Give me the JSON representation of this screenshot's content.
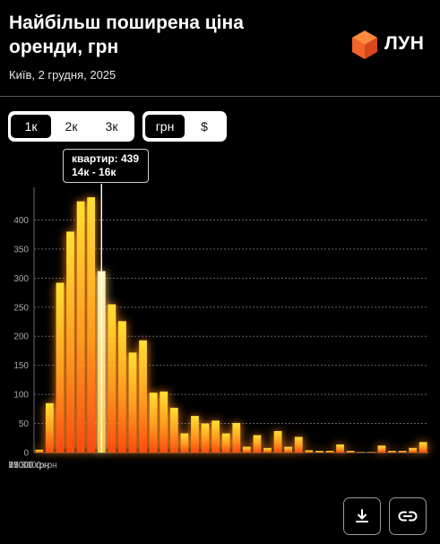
{
  "header": {
    "title": "Найбільш поширена ціна оренди, грн",
    "subtitle": "Київ, 2 грудня, 2025",
    "logo_text": "ЛУН",
    "logo_icon": "orange-cube-icon",
    "brand_color": "#F2642A"
  },
  "controls": {
    "step_options": [
      "1к",
      "2к",
      "3к"
    ],
    "step_active": "1к",
    "currency_options": [
      "грн",
      "$"
    ],
    "currency_active": "грн"
  },
  "tooltip": {
    "line1": "квартир: 439",
    "line2": "14к - 16к"
  },
  "actions": {
    "download_icon": "download-icon",
    "link_icon": "link-icon"
  },
  "chart_data": {
    "type": "bar",
    "title": "Найбільш поширена ціна оренди, грн",
    "subtitle": "Київ, 2 грудня, 2025",
    "xlabel": "",
    "ylabel": "",
    "ylim": [
      0,
      450
    ],
    "yticks": [
      0,
      50,
      100,
      150,
      200,
      250,
      300,
      350,
      400
    ],
    "xticks": [
      "3000 грн",
      "15000 грн",
      "27000 грн",
      "39000 грн",
      "51000 грн",
      "63000 грн",
      "75000 грн"
    ],
    "xtick_categories": [
      "3к - 4к",
      "15к - 16к",
      "27к - 28к",
      "39к - 40к",
      "51к - 52к",
      "63к - 64к",
      "75к - 76к"
    ],
    "grid": true,
    "highlighted": "14к - 16к",
    "categories": [
      "3к - 4к",
      "4к - 6к",
      "6к - 8к",
      "8к - 10к",
      "10к - 12к",
      "12к - 14к",
      "14к - 16к",
      "16к - 18к",
      "18к - 20к",
      "20к - 22к",
      "22к - 24к",
      "24к - 26к",
      "26к - 28к",
      "28к - 30к",
      "30к - 32к",
      "32к - 34к",
      "34к - 36к",
      "36к - 38к",
      "38к - 40к",
      "40к - 42к",
      "42к - 44к",
      "44к - 46к",
      "46к - 48к",
      "48к - 50к",
      "50к - 52к",
      "52к - 54к",
      "54к - 56к",
      "56к - 58к",
      "58к - 60к",
      "60к - 62к",
      "62к - 64к",
      "64к - 66к",
      "66к - 68к",
      "68к - 70к",
      "70к - 72к",
      "72к - 74к",
      "74к - 76к",
      "76к - 78к"
    ],
    "values": [
      5,
      85,
      292,
      380,
      432,
      439,
      312,
      255,
      226,
      172,
      193,
      103,
      105,
      77,
      33,
      63,
      50,
      55,
      33,
      51,
      10,
      30,
      8,
      37,
      10,
      27,
      4,
      3,
      3,
      14,
      3,
      1,
      1,
      12,
      3,
      3,
      8,
      18
    ]
  }
}
